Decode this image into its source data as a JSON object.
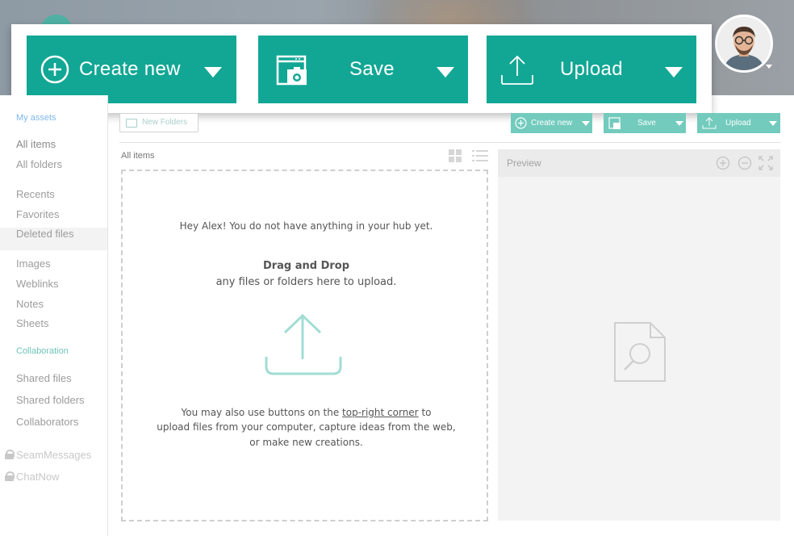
{
  "header": {
    "avatar_alt": "user-avatar"
  },
  "callout": {
    "create_label": "Create new",
    "save_label": "Save",
    "upload_label": "Upload",
    "accent": "#12a795"
  },
  "sidebar": {
    "section_title": "My assets",
    "items": [
      {
        "label": "All items",
        "active": true
      },
      {
        "label": "All folders"
      },
      {
        "label": "Recents"
      },
      {
        "label": "Favorites"
      },
      {
        "label": "Deleted files"
      },
      {
        "label": "Images"
      },
      {
        "label": "Weblinks"
      },
      {
        "label": "Notes"
      },
      {
        "label": "Sheets"
      }
    ],
    "collab_heading": "Collaboration",
    "collab_items": [
      {
        "label": "Shared files"
      },
      {
        "label": "Shared folders"
      },
      {
        "label": "Collaborators"
      }
    ],
    "locked_items": [
      {
        "label": "SeamMessages"
      },
      {
        "label": "ChatNow"
      }
    ]
  },
  "toolbar": {
    "new_folder_label": "New Folders",
    "create_label": "Create new",
    "save_label": "Save",
    "upload_label": "Upload"
  },
  "items_area": {
    "title": "All items",
    "greeting": "Hey Alex! You do not have anything in your hub yet.",
    "drag_title": "Drag and Drop",
    "drag_sub": "any files or folders here to upload.",
    "hint_prefix": "You may also use buttons on the ",
    "hint_link": "top-right corner",
    "hint_suffix": " to",
    "hint_line2": "upload files from your computer, capture ideas from the web,",
    "hint_line3": "or make new creations."
  },
  "preview": {
    "title": "Preview"
  }
}
